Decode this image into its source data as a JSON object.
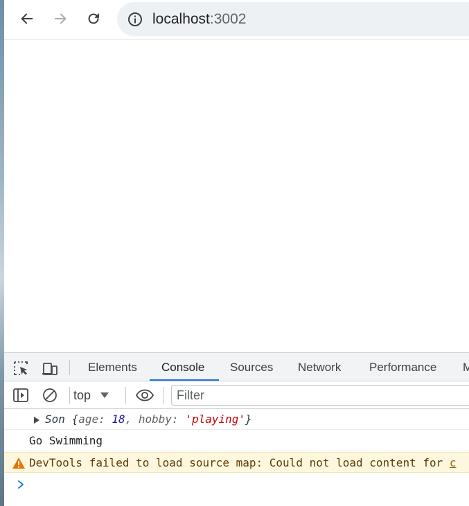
{
  "browser": {
    "url_host": "localhost",
    "url_port": ":3002"
  },
  "devtools": {
    "tabs": [
      {
        "label": "Elements"
      },
      {
        "label": "Console"
      },
      {
        "label": "Sources"
      },
      {
        "label": "Network"
      },
      {
        "label": "Performance"
      },
      {
        "label": "M"
      }
    ],
    "active_tab": "Console",
    "console_bar": {
      "context": "top",
      "filter_placeholder": "Filter"
    },
    "messages": {
      "object": {
        "name": "Son",
        "open": "{",
        "key1": "age: ",
        "val1": "18",
        "sep": ", ",
        "key2": "hobby: ",
        "val2": "'playing'",
        "close": "}"
      },
      "log": "Go Swimming",
      "warning": {
        "text": "DevTools failed to load source map: Could not load content for ",
        "link": "c"
      }
    },
    "colors": {
      "accent": "#1a73e8",
      "warning_bg": "#fef7e0",
      "warning_icon": "#e37400"
    },
    "icons": [
      "inspect-element-icon",
      "device-toolbar-icon",
      "sidebar-toggle-icon",
      "clear-console-icon",
      "live-expression-eye-icon",
      "warning-icon",
      "prompt-chevron-icon"
    ]
  }
}
